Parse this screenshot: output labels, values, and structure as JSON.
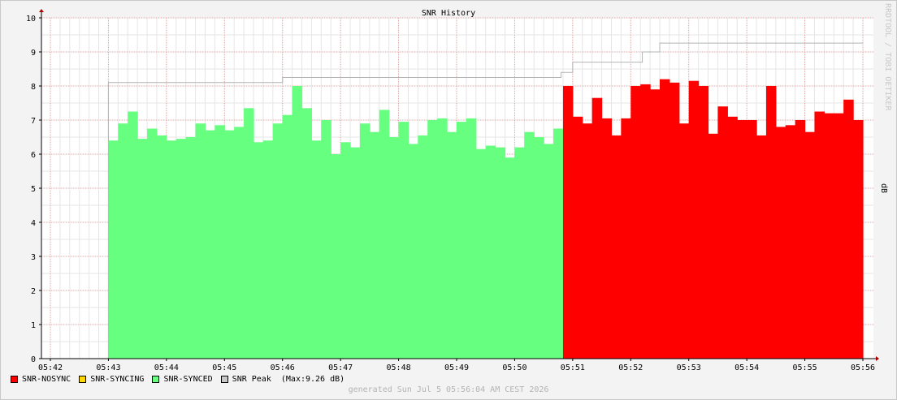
{
  "chart_data": {
    "type": "area",
    "title": "SNR History",
    "ylabel": "dB",
    "watermark": "RRDTOOL / TOBI OETIKER",
    "x_ticks": [
      "05:42",
      "05:43",
      "05:44",
      "05:45",
      "05:46",
      "05:47",
      "05:48",
      "05:49",
      "05:50",
      "05:51",
      "05:52",
      "05:53",
      "05:54",
      "05:55",
      "05:56"
    ],
    "y_ticks": [
      "0",
      "1",
      "2",
      "3",
      "4",
      "5",
      "6",
      "7",
      "8",
      "9",
      "10"
    ],
    "ylim": [
      0,
      10
    ],
    "grid": true,
    "series": [
      {
        "name": "SNR-SYNCED",
        "color": "#66ff80",
        "values": [
          6.4,
          6.9,
          7.25,
          6.45,
          6.75,
          6.55,
          6.4,
          6.45,
          6.5,
          6.9,
          6.7,
          6.85,
          6.7,
          6.8,
          7.35,
          6.35,
          6.4,
          6.9,
          7.15,
          8.0,
          7.35,
          6.4,
          7.0,
          6.0,
          6.35,
          6.2,
          6.9,
          6.65,
          7.3,
          6.5,
          6.95,
          6.3,
          6.55,
          7.0,
          7.05,
          6.65,
          6.95,
          7.05,
          6.15,
          6.25,
          6.2,
          5.9,
          6.2,
          6.65,
          6.5,
          6.3,
          6.75
        ]
      },
      {
        "name": "SNR-NOSYNC",
        "color": "#ff0000",
        "values": [
          8.0,
          7.1,
          6.9,
          7.65,
          7.05,
          6.55,
          7.05,
          8.0,
          8.05,
          7.9,
          8.2,
          8.1,
          6.9,
          8.15,
          8.0,
          6.6,
          7.4,
          7.1,
          7.0,
          7.0,
          6.55,
          8.0,
          6.8,
          6.85,
          7.0,
          6.65,
          7.25,
          7.2,
          7.2,
          7.6,
          7.0
        ]
      },
      {
        "name": "SNR-SYNCING",
        "color": "#ffd700",
        "values": []
      },
      {
        "name": "SNR Peak",
        "color": "#c8c8c8",
        "steps": [
          [
            "05:43",
            8.1
          ],
          [
            "05:46",
            8.25
          ],
          [
            "05:50.8",
            8.4
          ],
          [
            "05:51",
            8.7
          ],
          [
            "05:52.2",
            9.0
          ],
          [
            "05:52.5",
            9.26
          ],
          [
            "05:56",
            9.26
          ]
        ]
      }
    ],
    "start": "05:43",
    "end": "05:56"
  },
  "legend": [
    {
      "label": "SNR-NOSYNC",
      "color": "#ff0000"
    },
    {
      "label": "SNR-SYNCING",
      "color": "#ffd700"
    },
    {
      "label": "SNR-SYNCED",
      "color": "#66ff80"
    },
    {
      "label": "SNR Peak  (Max:9.26 dB)",
      "color": "#c8c8c8"
    }
  ],
  "footer": "generated Sun Jul  5 05:56:04 AM CEST 2026"
}
